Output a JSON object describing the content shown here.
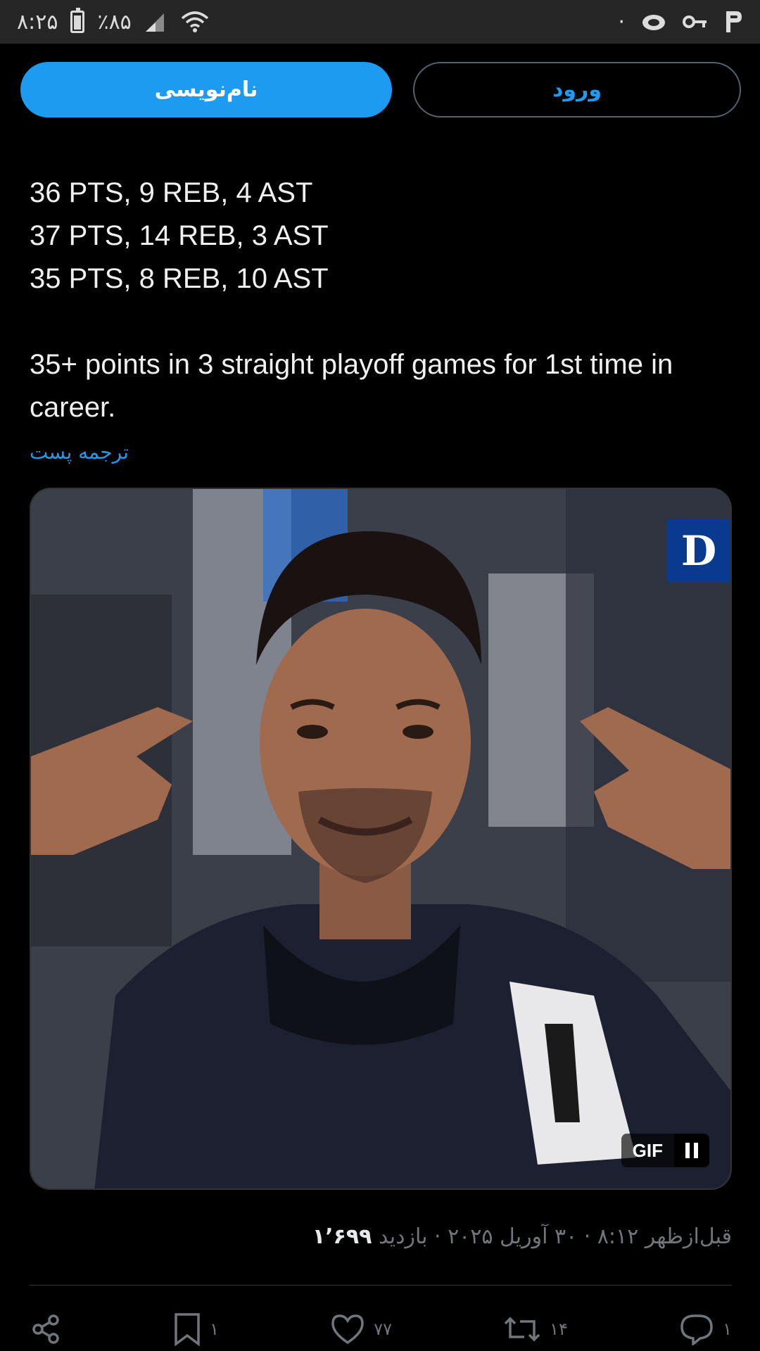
{
  "status_bar": {
    "time": "۸:۲۵",
    "battery": "٪۸۵",
    "left_dot": "·"
  },
  "auth": {
    "signup_label": "نام‌نویسی",
    "login_label": "ورود"
  },
  "tweet": {
    "lines": [
      "36 PTS, 9 REB, 4 AST",
      "37 PTS, 14 REB, 3 AST",
      "35 PTS, 8 REB, 10 AST"
    ],
    "paragraph_line1": "35+ points in 3 straight playoff games for 1st time in",
    "paragraph_line2": "career.",
    "translate_label": "ترجمه پست"
  },
  "media": {
    "logo_text": "D",
    "gif_label": "GIF",
    "pause_icon": "pause-icon"
  },
  "meta": {
    "time_text": "قبل‌ازظهر ۸:۱۲ · ۳۰ آوریل ۲۰۲۵ · ",
    "views_count": "۱٬۶۹۹",
    "views_label": "بازدید "
  },
  "actions": {
    "share_icon": "share-icon",
    "bookmark_count": "۱",
    "like_count": "۷۷",
    "repost_count": "۱۴",
    "reply_count": "۱"
  },
  "colors": {
    "accent": "#1d9bf0",
    "background": "#000000",
    "muted": "#71767b"
  }
}
